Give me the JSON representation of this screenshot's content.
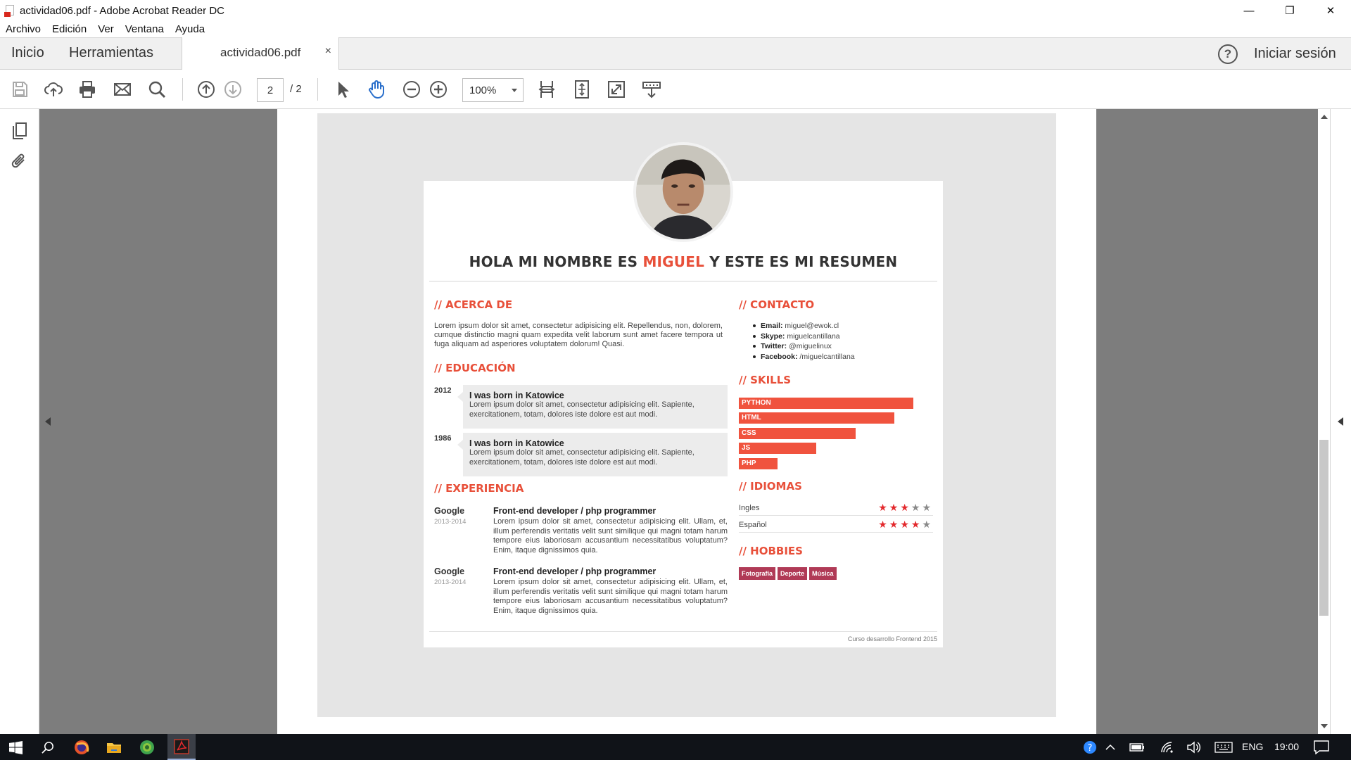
{
  "window": {
    "title": "actividad06.pdf - Adobe Acrobat Reader DC",
    "controls": {
      "minimize": "—",
      "restore": "❐",
      "close": "✕"
    }
  },
  "menu": [
    "Archivo",
    "Edición",
    "Ver",
    "Ventana",
    "Ayuda"
  ],
  "tabs": {
    "home": "Inicio",
    "tools": "Herramientas",
    "document": "actividad06.pdf",
    "close_glyph": "×",
    "help_glyph": "?",
    "sign_in": "Iniciar sesión"
  },
  "toolbar": {
    "page_current": "2",
    "page_total": "/ 2",
    "zoom": "100%",
    "icons": [
      "save-icon",
      "upload-icon",
      "print-icon",
      "mail-icon",
      "search-icon",
      "page-up-icon",
      "page-down-icon",
      "select-icon",
      "hand-icon",
      "zoom-out-icon",
      "zoom-in-icon",
      "fit-width-icon",
      "fit-page-icon",
      "fullscreen-icon",
      "read-mode-icon"
    ]
  },
  "resume": {
    "title_pre": "HOLA MI NOMBRE ES ",
    "title_name": "MIGUEL",
    "title_post": " Y ESTE ES MI RESUMEN",
    "about_heading": "// ACERCA DE",
    "about_text": "Lorem ipsum dolor sit amet, consectetur adipisicing elit. Repellendus, non, dolorem, cumque distinctio magni quam expedita velit laborum sunt amet facere tempora ut fuga aliquam ad asperiores voluptatem dolorum! Quasi.",
    "education_heading": "// EDUCACIÓN",
    "education": [
      {
        "year": "2012",
        "title": "I was born in Katowice",
        "desc": "Lorem ipsum dolor sit amet, consectetur adipisicing elit. Sapiente, exercitationem, totam, dolores iste dolore est aut modi."
      },
      {
        "year": "1986",
        "title": "I was born in Katowice",
        "desc": "Lorem ipsum dolor sit amet, consectetur adipisicing elit. Sapiente, exercitationem, totam, dolores iste dolore est aut modi."
      }
    ],
    "experience_heading": "// EXPERIENCIA",
    "experience": [
      {
        "company": "Google",
        "years": "2013-2014",
        "role": "Front-end developer / php programmer",
        "desc": "Lorem ipsum dolor sit amet, consectetur adipisicing elit. Ullam, et, illum perferendis veritatis velit sunt similique qui magni totam harum tempore eius laboriosam accusantium necessitatibus voluptatum? Enim, itaque dignissimos quia."
      },
      {
        "company": "Google",
        "years": "2013-2014",
        "role": "Front-end developer / php programmer",
        "desc": "Lorem ipsum dolor sit amet, consectetur adipisicing elit. Ullam, et, illum perferendis veritatis velit sunt similique qui magni totam harum tempore eius laboriosam accusantium necessitatibus voluptatum? Enim, itaque dignissimos quia."
      }
    ],
    "contact_heading": "// CONTACTO",
    "contact": [
      {
        "label": "Email:",
        "value": " miguel@ewok.cl"
      },
      {
        "label": "Skype:",
        "value": " miguelcantillana"
      },
      {
        "label": "Twitter:",
        "value": " @miguelinux"
      },
      {
        "label": "Facebook:",
        "value": " /miguelcantillana"
      }
    ],
    "skills_heading": "// SKILLS",
    "skills": [
      {
        "name": "PYTHON",
        "level": 0.9
      },
      {
        "name": "HTML",
        "level": 0.8
      },
      {
        "name": "CSS",
        "level": 0.6
      },
      {
        "name": "JS",
        "level": 0.4
      },
      {
        "name": "PHP",
        "level": 0.2
      }
    ],
    "languages_heading": "// IDIOMAS",
    "languages": [
      {
        "name": "Ingles",
        "stars": 3,
        "max": 5
      },
      {
        "name": "Español",
        "stars": 4,
        "max": 5
      }
    ],
    "hobbies_heading": "// HOBBIES",
    "hobbies": [
      "Fotografía",
      "Deporte",
      "Música"
    ],
    "footer": "Curso desarrollo Frontend 2015",
    "accent_color": "#e8503a"
  },
  "taskbar": {
    "language": "ENG",
    "time": "19:00",
    "apps": [
      "windows-start-icon",
      "search-icon",
      "firefox-icon",
      "file-explorer-icon",
      "chrome-icon",
      "acrobat-icon"
    ]
  }
}
